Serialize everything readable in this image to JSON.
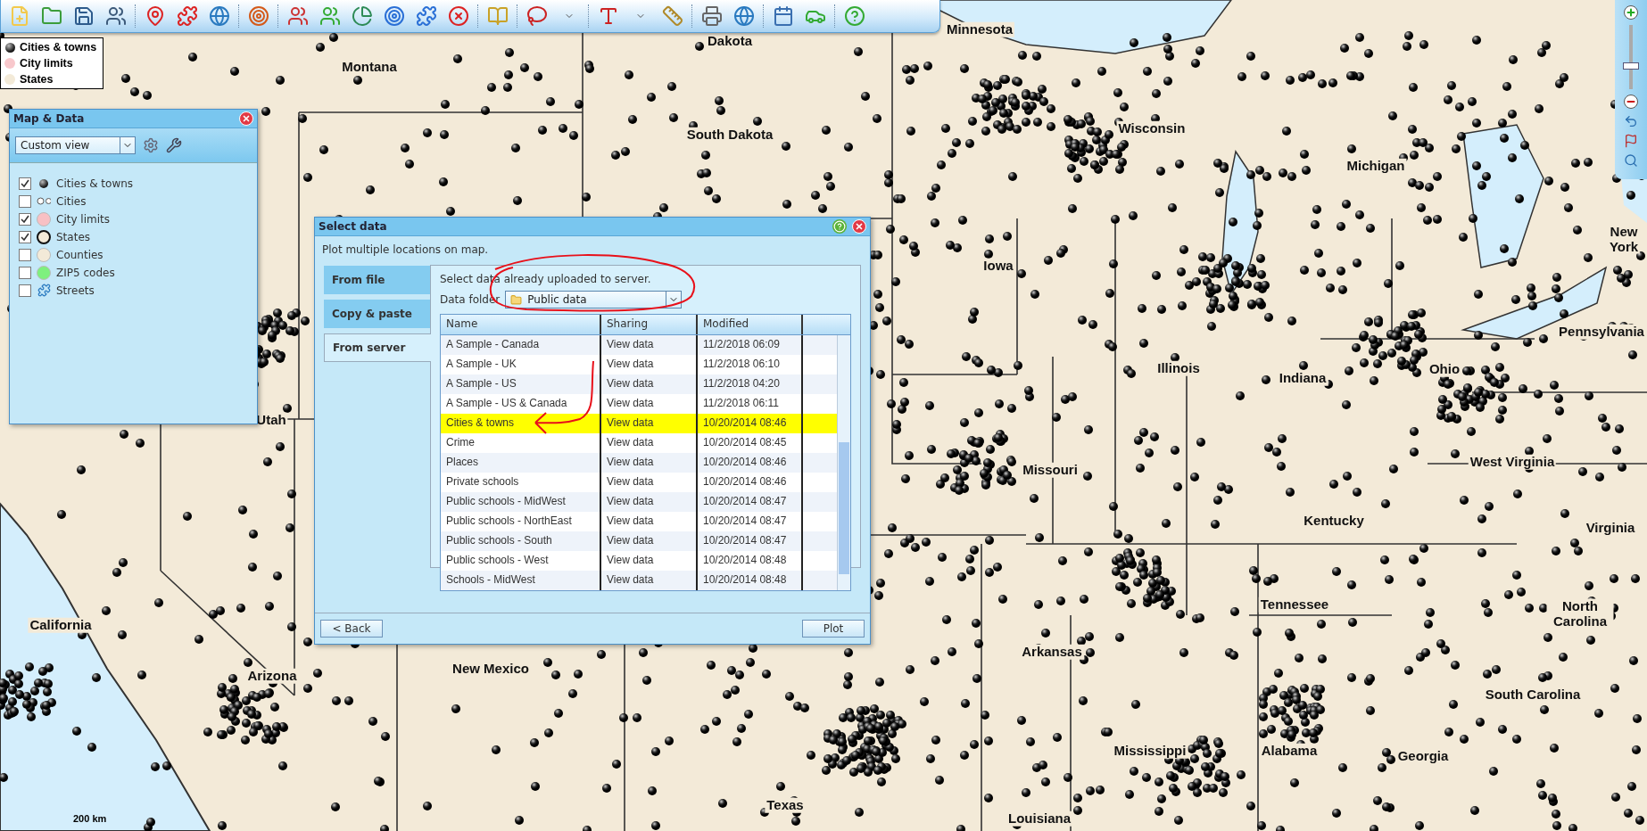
{
  "legend": [
    {
      "label": "Cities & towns",
      "kind": "dot"
    },
    {
      "label": "City limits",
      "kind": "fill",
      "color": "#f8c8cc"
    },
    {
      "label": "States",
      "kind": "fill",
      "color": "#f3ead8"
    }
  ],
  "map_labels": [
    "Dakota",
    "Minnesota",
    "Montana",
    "South Dakota",
    "Wisconsin",
    "Michigan",
    "New York",
    "Iowa",
    "Pennsylvania",
    "Illinois",
    "Indiana",
    "Ohio",
    "Utah",
    "Missouri",
    "West Virginia",
    "Kentucky",
    "Virginia",
    "California",
    "Tennessee",
    "North Carolina",
    "Arizona",
    "New Mexico",
    "Arkansas",
    "South Carolina",
    "Mississippi",
    "Alabama",
    "Georgia",
    "Texas",
    "Louisiana"
  ],
  "scale_label": "200 km",
  "zoom": {
    "level": 0.35
  },
  "map_data_panel": {
    "title": "Map & Data",
    "view": "Custom view",
    "layers": [
      {
        "label": "Cities & towns",
        "kind": "dot",
        "checked": true
      },
      {
        "label": "Cities",
        "kind": "rings",
        "checked": false
      },
      {
        "label": "City limits",
        "kind": "fill",
        "color": "#f8c0c4",
        "checked": true
      },
      {
        "label": "States",
        "kind": "outline",
        "color": "#f3ead8",
        "checked": true
      },
      {
        "label": "Counties",
        "kind": "fill",
        "color": "#f3ead8",
        "checked": false
      },
      {
        "label": "ZIP5 codes",
        "kind": "fill",
        "color": "#7ef07e",
        "checked": false
      },
      {
        "label": "Streets",
        "kind": "streets",
        "checked": false
      }
    ]
  },
  "dialog": {
    "title": "Select data",
    "description": "Plot multiple locations on map.",
    "tabs": [
      {
        "label": "From file",
        "selected": false
      },
      {
        "label": "Copy & paste",
        "selected": false
      },
      {
        "label": "From server",
        "selected": true
      }
    ],
    "hint": "Select data already uploaded to server.",
    "folder_label": "Data folder",
    "folder": "Public data",
    "columns": [
      "Name",
      "Sharing",
      "Modified"
    ],
    "rows": [
      {
        "name": "A Sample - Canada",
        "sharing": "View data",
        "modified": "11/2/2018 06:09",
        "selected": false
      },
      {
        "name": "A Sample - UK",
        "sharing": "View data",
        "modified": "11/2/2018 06:10",
        "selected": false
      },
      {
        "name": "A Sample - US",
        "sharing": "View data",
        "modified": "11/2/2018 04:20",
        "selected": false
      },
      {
        "name": "A Sample - US & Canada",
        "sharing": "View data",
        "modified": "11/2/2018 06:11",
        "selected": false
      },
      {
        "name": "Cities & towns",
        "sharing": "View data",
        "modified": "10/20/2014 08:46",
        "selected": true
      },
      {
        "name": "Crime",
        "sharing": "View data",
        "modified": "10/20/2014 08:45",
        "selected": false
      },
      {
        "name": "Places",
        "sharing": "View data",
        "modified": "10/20/2014 08:46",
        "selected": false
      },
      {
        "name": "Private schools",
        "sharing": "View data",
        "modified": "10/20/2014 08:46",
        "selected": false
      },
      {
        "name": "Public schools - MidWest",
        "sharing": "View data",
        "modified": "10/20/2014 08:47",
        "selected": false
      },
      {
        "name": "Public schools - NorthEast",
        "sharing": "View data",
        "modified": "10/20/2014 08:47",
        "selected": false
      },
      {
        "name": "Public schools - South",
        "sharing": "View data",
        "modified": "10/20/2014 08:47",
        "selected": false
      },
      {
        "name": "Public schools - West",
        "sharing": "View data",
        "modified": "10/20/2014 08:48",
        "selected": false
      },
      {
        "name": "Schools - MidWest",
        "sharing": "View data",
        "modified": "10/20/2014 08:48",
        "selected": false
      }
    ],
    "back": "< Back",
    "plot": "Plot"
  }
}
